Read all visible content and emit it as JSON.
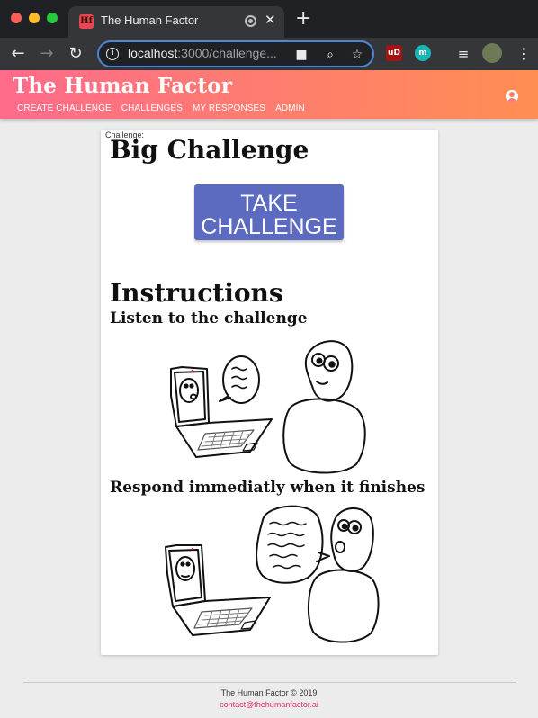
{
  "browser": {
    "tab_title": "The Human Factor",
    "tab_favicon": "Hf",
    "url_host": "localhost",
    "url_path": ":3000/challenge...",
    "extensions": [
      "uBlock",
      "m"
    ]
  },
  "app": {
    "brand": "The Human Factor",
    "nav": [
      "CREATE CHALLENGE",
      "CHALLENGES",
      "MY RESPONSES",
      "ADMIN"
    ]
  },
  "challenge": {
    "label": "Challenge:",
    "title": "Big Challenge",
    "take_button": "TAKE CHALLENGE"
  },
  "instructions": {
    "heading": "Instructions",
    "step1": "Listen to the challenge",
    "step2": "Respond immediatly when it finishes"
  },
  "footer": {
    "copyright": "The Human Factor © 2019",
    "email": "contact@thehumanfactor.ai"
  },
  "colors": {
    "gradient_start": "#fe6b8b",
    "gradient_end": "#ff8e53",
    "button": "#5c6bc0",
    "email": "#e0306a"
  }
}
